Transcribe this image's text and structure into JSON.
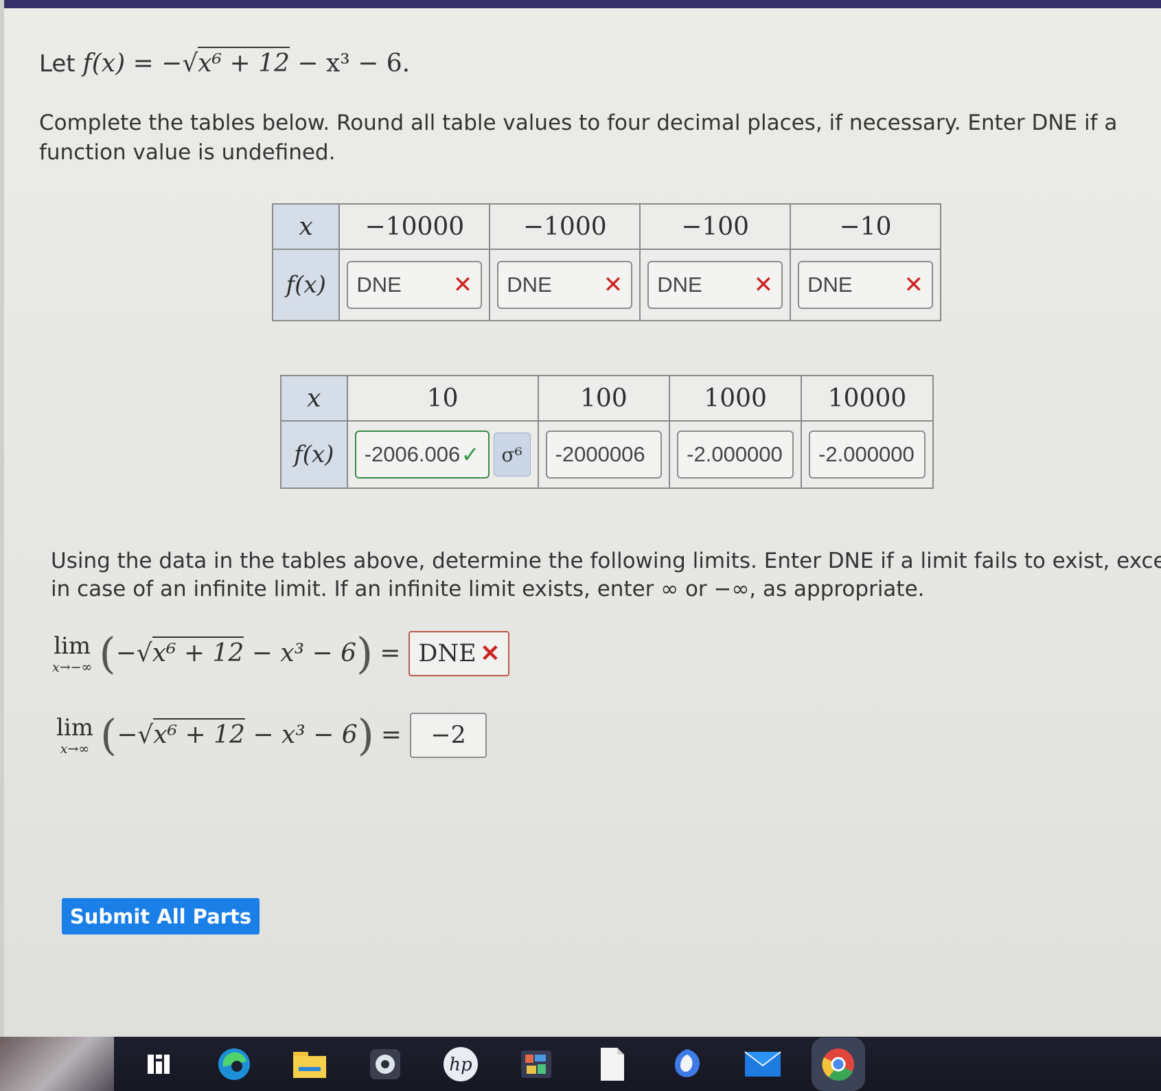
{
  "problem": {
    "let": "Let",
    "fx": "f(x)",
    "eq": " = −",
    "radicand": "x⁶ + 12",
    "rest": " − x³ − 6."
  },
  "instructions": "Complete the tables below. Round all table values to four decimal places, if necessary. Enter DNE if a function value is undefined.",
  "table1": {
    "x_label": "x",
    "fx_label": "f(x)",
    "headers": [
      "−10000",
      "−1000",
      "−100",
      "−10"
    ],
    "answers": [
      "DNE",
      "DNE",
      "DNE",
      "DNE"
    ],
    "status": [
      "incorrect",
      "incorrect",
      "incorrect",
      "incorrect"
    ]
  },
  "table2": {
    "x_label": "x",
    "fx_label": "f(x)",
    "headers": [
      "10",
      "100",
      "1000",
      "10000"
    ],
    "answers": [
      "-2006.006",
      "-2000006",
      "-2.000000",
      "-2.000000"
    ],
    "status": [
      "correct",
      "none",
      "none",
      "none"
    ],
    "keypad_icon": "σ⁶"
  },
  "instructions2": {
    "line1": "Using the data in the tables above, determine the following limits. Enter DNE if a limit fails to exist, except",
    "line2": "in case of an infinite limit. If an infinite limit exists, enter ∞ or −∞, as appropriate."
  },
  "limits": [
    {
      "word": "lim",
      "sub": "x→−∞",
      "expr_pre": "−√",
      "radicand": "x⁶ + 12",
      "expr_post": " − x³ − 6",
      "answer": "DNE",
      "status": "incorrect"
    },
    {
      "word": "lim",
      "sub": "x→∞",
      "expr_pre": "−√",
      "radicand": "x⁶ + 12",
      "expr_post": " − x³ − 6",
      "answer": "−2",
      "status": "none"
    }
  ],
  "symbols": {
    "open_paren": "(",
    "close_paren": ")",
    "equals": "=",
    "x_mark": "✕",
    "check_mark": "✓"
  },
  "submit_label": "Submit All Parts",
  "taskbar_icons": [
    "task-view-icon",
    "edge-icon",
    "file-explorer-icon",
    "webcam-icon",
    "hp-icon",
    "photos-icon",
    "notepad-icon",
    "copilot-icon",
    "mail-icon",
    "chrome-icon"
  ]
}
